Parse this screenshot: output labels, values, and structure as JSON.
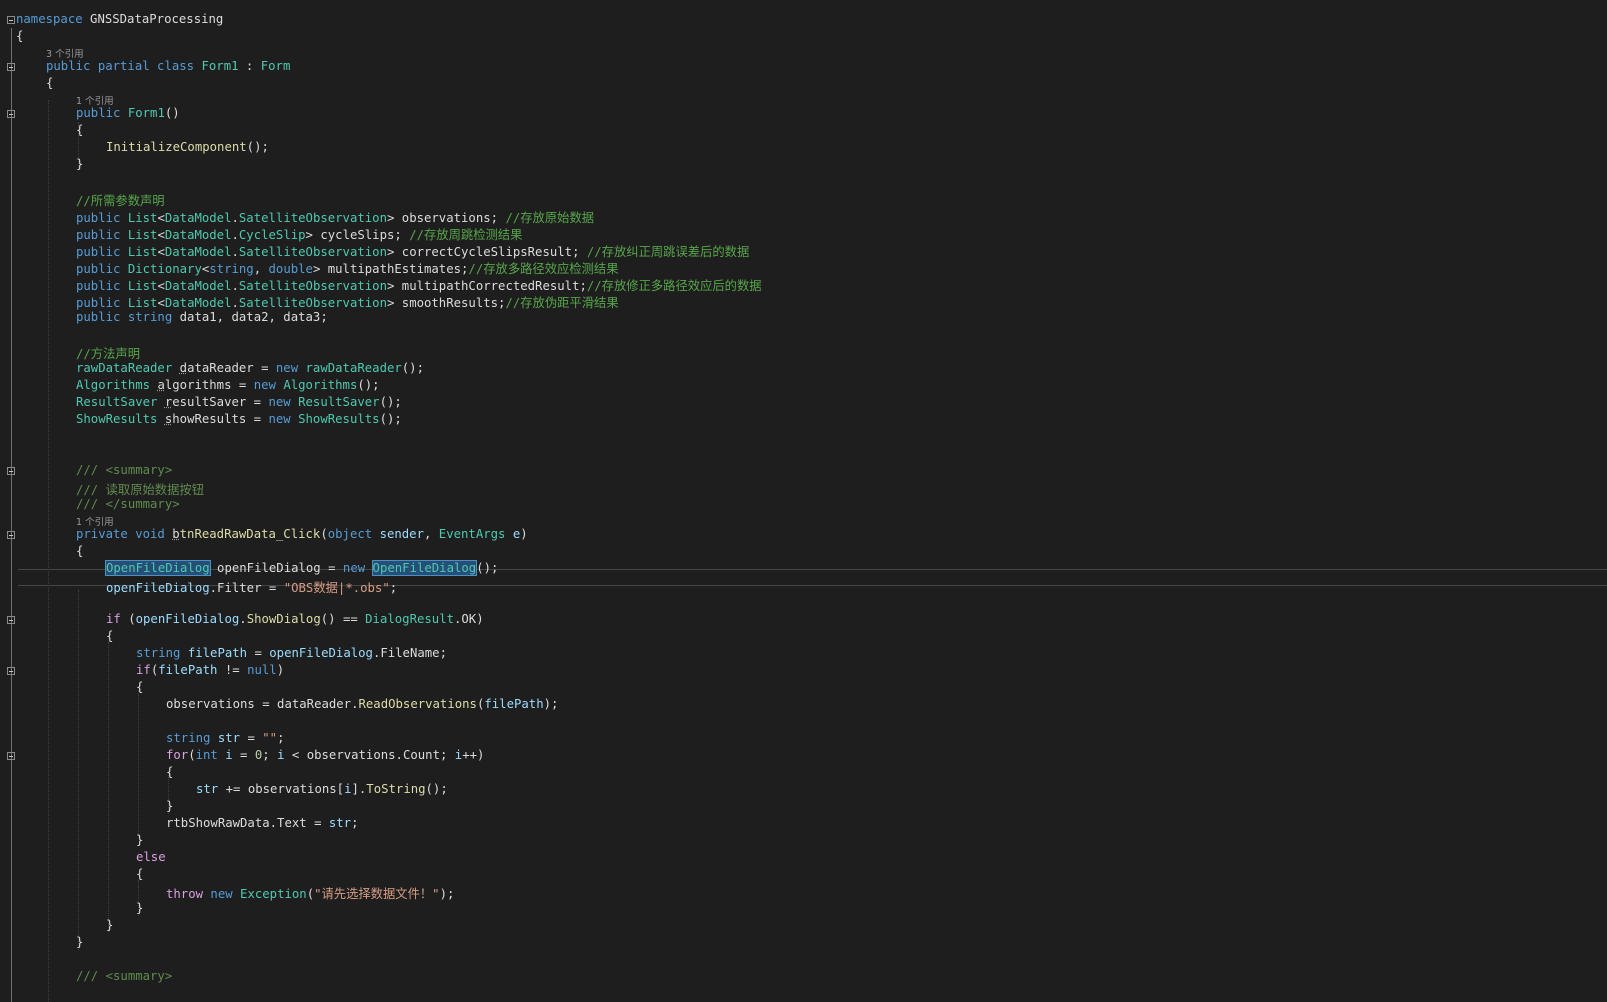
{
  "editor": {
    "lines": [
      {
        "tokens": [
          [
            "k",
            "namespace"
          ],
          [
            "p",
            " GNSSDataProcessing"
          ]
        ]
      },
      {
        "tokens": [
          [
            "p",
            "{"
          ]
        ]
      },
      {
        "lens": "3 个引用"
      },
      {
        "tokens": [
          [
            "k",
            "public partial class "
          ],
          [
            "t",
            "Form1"
          ],
          [
            "p",
            " : "
          ],
          [
            "t",
            "Form"
          ]
        ]
      },
      {
        "tokens": [
          [
            "p",
            "{"
          ]
        ]
      },
      {
        "lens": "1 个引用"
      },
      {
        "tokens": [
          [
            "k",
            "public "
          ],
          [
            "t",
            "Form1"
          ],
          [
            "p",
            "()"
          ]
        ]
      },
      {
        "tokens": [
          [
            "p",
            "{"
          ]
        ]
      },
      {
        "tokens": [
          [
            "m",
            "InitializeComponent"
          ],
          [
            "p",
            "();"
          ]
        ]
      },
      {
        "tokens": [
          [
            "p",
            "}"
          ]
        ]
      },
      {
        "tokens": []
      },
      {
        "tokens": [
          [
            "c",
            "//所需参数声明"
          ]
        ]
      },
      {
        "tokens": [
          [
            "k",
            "public "
          ],
          [
            "t",
            "List"
          ],
          [
            "p",
            "<"
          ],
          [
            "t",
            "DataModel"
          ],
          [
            "p",
            "."
          ],
          [
            "t",
            "SatelliteObservation"
          ],
          [
            "p",
            "> observations; "
          ],
          [
            "c",
            "//存放原始数据"
          ]
        ]
      },
      {
        "tokens": [
          [
            "k",
            "public "
          ],
          [
            "t",
            "List"
          ],
          [
            "p",
            "<"
          ],
          [
            "t",
            "DataModel"
          ],
          [
            "p",
            "."
          ],
          [
            "t",
            "CycleSlip"
          ],
          [
            "p",
            "> cycleSlips; "
          ],
          [
            "c",
            "//存放周跳检测结果"
          ]
        ]
      },
      {
        "tokens": [
          [
            "k",
            "public "
          ],
          [
            "t",
            "List"
          ],
          [
            "p",
            "<"
          ],
          [
            "t",
            "DataModel"
          ],
          [
            "p",
            "."
          ],
          [
            "t",
            "SatelliteObservation"
          ],
          [
            "p",
            "> correctCycleSlipsResult; "
          ],
          [
            "c",
            "//存放纠正周跳误差后的数据"
          ]
        ]
      },
      {
        "tokens": [
          [
            "k",
            "public "
          ],
          [
            "t",
            "Dictionary"
          ],
          [
            "p",
            "<"
          ],
          [
            "k",
            "string"
          ],
          [
            "p",
            ", "
          ],
          [
            "k",
            "double"
          ],
          [
            "p",
            "> multipathEstimates;"
          ],
          [
            "c",
            "//存放多路径效应检测结果"
          ]
        ]
      },
      {
        "tokens": [
          [
            "k",
            "public "
          ],
          [
            "t",
            "List"
          ],
          [
            "p",
            "<"
          ],
          [
            "t",
            "DataModel"
          ],
          [
            "p",
            "."
          ],
          [
            "t",
            "SatelliteObservation"
          ],
          [
            "p",
            "> multipathCorrectedResult;"
          ],
          [
            "c",
            "//存放修正多路径效应后的数据"
          ]
        ]
      },
      {
        "tokens": [
          [
            "k",
            "public "
          ],
          [
            "t",
            "List"
          ],
          [
            "p",
            "<"
          ],
          [
            "t",
            "DataModel"
          ],
          [
            "p",
            "."
          ],
          [
            "t",
            "SatelliteObservation"
          ],
          [
            "p",
            "> smoothResults;"
          ],
          [
            "c",
            "//存放伪距平滑结果"
          ]
        ]
      },
      {
        "tokens": [
          [
            "k",
            "public string "
          ],
          [
            "p",
            "data1, data2, data3;"
          ]
        ]
      },
      {
        "tokens": []
      },
      {
        "tokens": [
          [
            "c",
            "//方法声明"
          ]
        ]
      },
      {
        "tokens": [
          [
            "t",
            "rawDataReader"
          ],
          [
            "p",
            " "
          ],
          [
            "sq",
            "d"
          ],
          [
            "p",
            "ataReader = "
          ],
          [
            "k",
            "new "
          ],
          [
            "t",
            "rawDataReader"
          ],
          [
            "p",
            "();"
          ]
        ]
      },
      {
        "tokens": [
          [
            "t",
            "Algorithms"
          ],
          [
            "p",
            " "
          ],
          [
            "sq",
            "a"
          ],
          [
            "p",
            "lgorithms = "
          ],
          [
            "k",
            "new "
          ],
          [
            "t",
            "Algorithms"
          ],
          [
            "p",
            "();"
          ]
        ]
      },
      {
        "tokens": [
          [
            "t",
            "ResultSaver"
          ],
          [
            "p",
            " "
          ],
          [
            "sq",
            "r"
          ],
          [
            "p",
            "esultSaver = "
          ],
          [
            "k",
            "new "
          ],
          [
            "t",
            "ResultSaver"
          ],
          [
            "p",
            "();"
          ]
        ]
      },
      {
        "tokens": [
          [
            "t",
            "ShowResults"
          ],
          [
            "p",
            " "
          ],
          [
            "sq",
            "s"
          ],
          [
            "p",
            "howResults = "
          ],
          [
            "k",
            "new "
          ],
          [
            "t",
            "ShowResults"
          ],
          [
            "p",
            "();"
          ]
        ]
      },
      {
        "tokens": []
      },
      {
        "tokens": []
      },
      {
        "tokens": [
          [
            "x",
            "/// <summary>"
          ]
        ]
      },
      {
        "tokens": [
          [
            "x",
            "/// 读取原始数据按钮"
          ]
        ]
      },
      {
        "tokens": [
          [
            "x",
            "/// </summary>"
          ]
        ]
      },
      {
        "lens": "1 个引用"
      },
      {
        "tokens": [
          [
            "k",
            "private void "
          ],
          [
            "sq",
            "b"
          ],
          [
            "m",
            "tnReadRawData_Click"
          ],
          [
            "p",
            "("
          ],
          [
            "k",
            "object "
          ],
          [
            "v",
            "sender"
          ],
          [
            "p",
            ", "
          ],
          [
            "t",
            "EventArgs "
          ],
          [
            "v",
            "e"
          ],
          [
            "p",
            ")"
          ]
        ]
      },
      {
        "tokens": [
          [
            "p",
            "{"
          ]
        ]
      },
      {
        "tokens": [
          [
            "hlt",
            "OpenFileDialog"
          ],
          [
            "p",
            " openFileDialog = "
          ],
          [
            "k",
            "new "
          ],
          [
            "hlt",
            "OpenFileDialog"
          ],
          [
            "p",
            "();"
          ]
        ]
      },
      {
        "tokens": [
          [
            "v",
            "openFileDialog"
          ],
          [
            "p",
            ".Filter = "
          ],
          [
            "s",
            "\"OBS数据|*.obs\""
          ],
          [
            "p",
            ";"
          ]
        ]
      },
      {
        "tokens": []
      },
      {
        "tokens": [
          [
            "ctl",
            "if "
          ],
          [
            "p",
            "("
          ],
          [
            "v",
            "openFileDialog"
          ],
          [
            "p",
            "."
          ],
          [
            "m",
            "ShowDialog"
          ],
          [
            "p",
            "() == "
          ],
          [
            "t",
            "DialogResult"
          ],
          [
            "p",
            ".OK)"
          ]
        ]
      },
      {
        "tokens": [
          [
            "p",
            "{"
          ]
        ]
      },
      {
        "tokens": [
          [
            "k",
            "string "
          ],
          [
            "v",
            "filePath"
          ],
          [
            "p",
            " = "
          ],
          [
            "v",
            "openFileDialog"
          ],
          [
            "p",
            ".FileName;"
          ]
        ]
      },
      {
        "tokens": [
          [
            "ctl",
            "if"
          ],
          [
            "p",
            "("
          ],
          [
            "v",
            "filePath"
          ],
          [
            "p",
            " != "
          ],
          [
            "k",
            "null"
          ],
          [
            "p",
            ")"
          ]
        ]
      },
      {
        "tokens": [
          [
            "p",
            "{"
          ]
        ]
      },
      {
        "tokens": [
          [
            "p",
            "observations = dataReader."
          ],
          [
            "m",
            "ReadObservations"
          ],
          [
            "p",
            "("
          ],
          [
            "v",
            "filePath"
          ],
          [
            "p",
            ");"
          ]
        ]
      },
      {
        "tokens": []
      },
      {
        "tokens": [
          [
            "k",
            "string "
          ],
          [
            "v",
            "str"
          ],
          [
            "p",
            " = "
          ],
          [
            "s",
            "\"\""
          ],
          [
            "p",
            ";"
          ]
        ]
      },
      {
        "tokens": [
          [
            "ctl",
            "for"
          ],
          [
            "p",
            "("
          ],
          [
            "k",
            "int "
          ],
          [
            "v",
            "i"
          ],
          [
            "p",
            " = "
          ],
          [
            "n",
            "0"
          ],
          [
            "p",
            "; "
          ],
          [
            "v",
            "i"
          ],
          [
            "p",
            " < observations.Count; "
          ],
          [
            "v",
            "i"
          ],
          [
            "p",
            "++)"
          ]
        ]
      },
      {
        "tokens": [
          [
            "p",
            "{"
          ]
        ]
      },
      {
        "tokens": [
          [
            "v",
            "str"
          ],
          [
            "p",
            " += observations["
          ],
          [
            "v",
            "i"
          ],
          [
            "p",
            "]."
          ],
          [
            "m",
            "ToString"
          ],
          [
            "p",
            "();"
          ]
        ]
      },
      {
        "tokens": [
          [
            "p",
            "}"
          ]
        ]
      },
      {
        "tokens": [
          [
            "p",
            "rtbShowRawData.Text = "
          ],
          [
            "v",
            "str"
          ],
          [
            "p",
            ";"
          ]
        ]
      },
      {
        "tokens": [
          [
            "p",
            "}"
          ]
        ]
      },
      {
        "tokens": [
          [
            "ctl",
            "else"
          ]
        ]
      },
      {
        "tokens": [
          [
            "p",
            "{"
          ]
        ]
      },
      {
        "tokens": [
          [
            "ctl",
            "throw "
          ],
          [
            "k",
            "new "
          ],
          [
            "t",
            "Exception"
          ],
          [
            "p",
            "("
          ],
          [
            "s",
            "\"请先选择数据文件！\""
          ],
          [
            "p",
            ");"
          ]
        ]
      },
      {
        "tokens": [
          [
            "p",
            "}"
          ]
        ]
      },
      {
        "tokens": [
          [
            "p",
            "}"
          ]
        ]
      },
      {
        "tokens": [
          [
            "p",
            "}"
          ]
        ]
      },
      {
        "tokens": []
      },
      {
        "tokens": [
          [
            "x",
            "/// <summary>"
          ]
        ]
      }
    ]
  }
}
